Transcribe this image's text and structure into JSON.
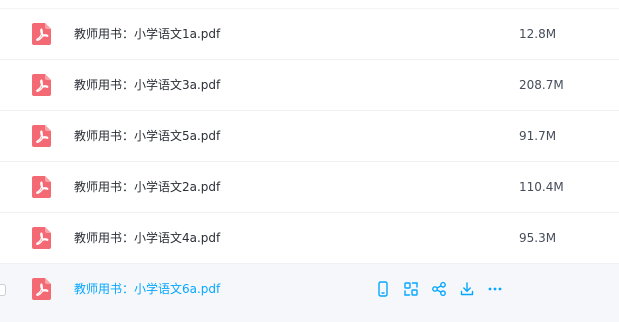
{
  "accent_color": "#06a7ff",
  "pdf_icon_color": "#f46a74",
  "files": [
    {
      "name": "教师用书：小学语文1a.pdf",
      "size": "12.8M"
    },
    {
      "name": "教师用书：小学语文3a.pdf",
      "size": "208.7M"
    },
    {
      "name": "教师用书：小学语文5a.pdf",
      "size": "91.7M"
    },
    {
      "name": "教师用书：小学语文2a.pdf",
      "size": "110.4M"
    },
    {
      "name": "教师用书：小学语文4a.pdf",
      "size": "95.3M"
    },
    {
      "name": "教师用书：小学语文6a.pdf",
      "size": ""
    }
  ],
  "hovered_row_actions": [
    "mobile-icon",
    "qr-scan-icon",
    "share-icon",
    "download-icon",
    "more-icon"
  ]
}
